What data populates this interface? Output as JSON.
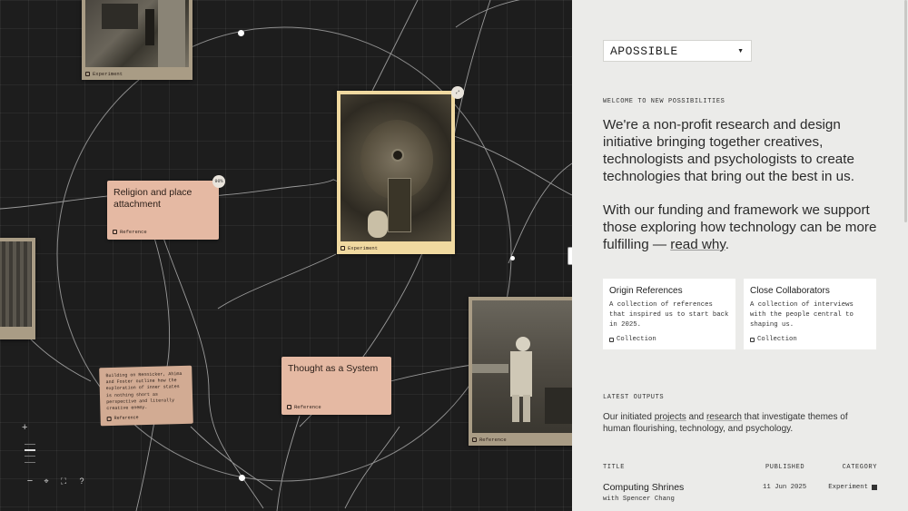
{
  "canvas": {
    "cards": {
      "religion": {
        "title": "Religion and place attachment",
        "tag": "Reference",
        "badge": "90%"
      },
      "thought": {
        "title": "Thought as a System",
        "tag": "Reference"
      },
      "small_note": {
        "text": "Building on Rennicker, Ahima and Foster outline how the exploration of inner states is nothing short as perspective and literally creative enemy.",
        "tag": "Reference"
      }
    },
    "photos": {
      "experiment": {
        "caption": "Experiment"
      },
      "top_left": {
        "caption": "Experiment"
      },
      "bottom_right": {
        "caption": "Reference"
      }
    },
    "controls": {
      "zoom_in": "+",
      "zoom_out": "−",
      "help": "?"
    }
  },
  "sidebar": {
    "brand": "APOSSIBLE",
    "welcome_label": "WELCOME TO NEW POSSIBILITIES",
    "intro": "We're a non-profit research and design initiative bringing together creatives, technologists and psychologists to create technologies that bring out the best in us.",
    "funding_text": "With our funding and framework we support those exploring how technology can be more fulfilling — ",
    "funding_link": "read why",
    "funding_end": ".",
    "collections": [
      {
        "title": "Origin References",
        "desc": "A collection of references that inspired us to start back in 2025.",
        "type": "Collection"
      },
      {
        "title": "Close Collaborators",
        "desc": "A collection of interviews with the people central to shaping us.",
        "type": "Collection"
      }
    ],
    "latest_label": "LATEST OUTPUTS",
    "latest_desc_pre": "Our initiated ",
    "latest_desc_projects": "projects",
    "latest_desc_mid": " and ",
    "latest_desc_research": "research",
    "latest_desc_post": " that investigate themes of human flourishing, technology, and psychology.",
    "table": {
      "headers": {
        "title": "TITLE",
        "published": "PUBLISHED",
        "category": "CATEGORY"
      },
      "rows": [
        {
          "title": "Computing Shrines",
          "subtitle": "with Spencer Chang",
          "published": "11 Jun 2025",
          "category": "Experiment"
        }
      ]
    }
  }
}
